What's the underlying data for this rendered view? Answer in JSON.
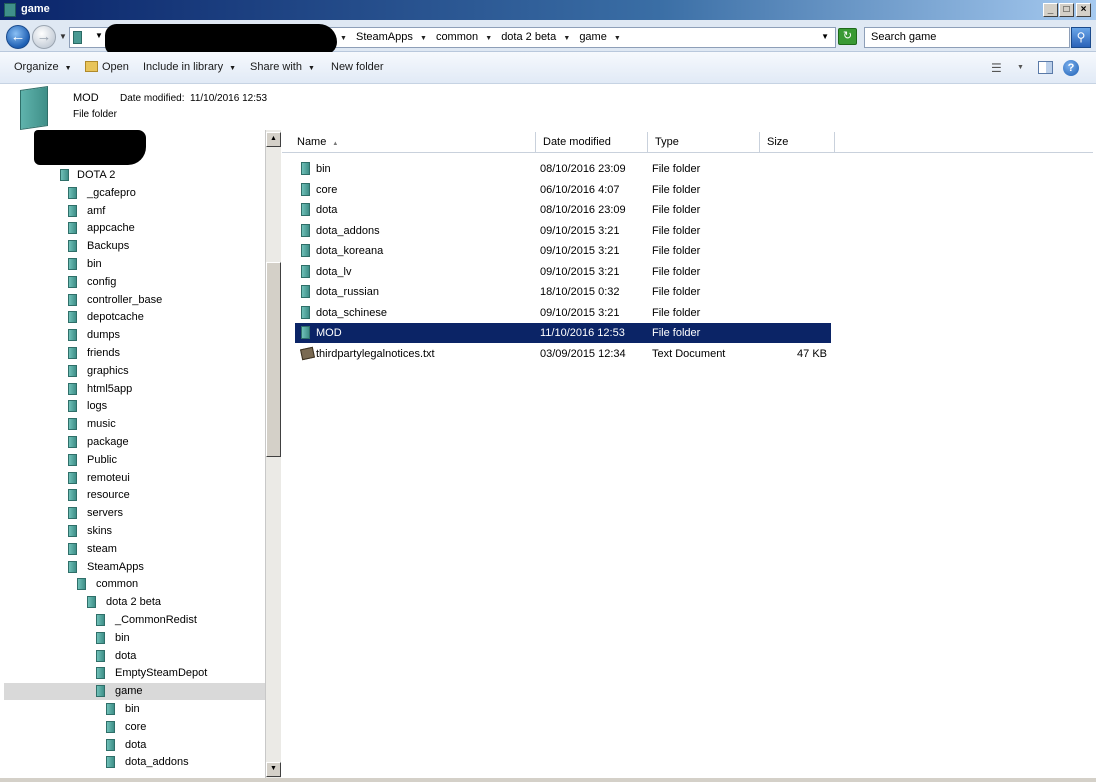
{
  "window": {
    "title": "game",
    "min_glyph": "_",
    "max_glyph": "□",
    "close_glyph": "×"
  },
  "address": {
    "crumbs": [
      "SteamApps",
      "common",
      "dota 2 beta",
      "game"
    ],
    "search_placeholder": "Search game"
  },
  "toolbar": {
    "organize": "Organize",
    "open": "Open",
    "include_in_library": "Include in library",
    "share_with": "Share with",
    "new_folder": "New folder"
  },
  "details": {
    "name": "MOD",
    "modified_label": "Date modified:",
    "modified_value": "11/10/2016 12:53",
    "type": "File folder"
  },
  "columns": {
    "name": "Name",
    "date": "Date modified",
    "type": "Type",
    "size": "Size"
  },
  "files": [
    {
      "name": "bin",
      "date": "08/10/2016 23:09",
      "type": "File folder",
      "size": "",
      "icon": "folder-icon"
    },
    {
      "name": "core",
      "date": "06/10/2016 4:07",
      "type": "File folder",
      "size": "",
      "icon": "folder-icon"
    },
    {
      "name": "dota",
      "date": "08/10/2016 23:09",
      "type": "File folder",
      "size": "",
      "icon": "folder-icon"
    },
    {
      "name": "dota_addons",
      "date": "09/10/2015 3:21",
      "type": "File folder",
      "size": "",
      "icon": "folder-icon"
    },
    {
      "name": "dota_koreana",
      "date": "09/10/2015 3:21",
      "type": "File folder",
      "size": "",
      "icon": "folder-icon"
    },
    {
      "name": "dota_lv",
      "date": "09/10/2015 3:21",
      "type": "File folder",
      "size": "",
      "icon": "folder-icon"
    },
    {
      "name": "dota_russian",
      "date": "18/10/2015 0:32",
      "type": "File folder",
      "size": "",
      "icon": "folder-icon"
    },
    {
      "name": "dota_schinese",
      "date": "09/10/2015 3:21",
      "type": "File folder",
      "size": "",
      "icon": "folder-icon"
    },
    {
      "name": "MOD",
      "date": "11/10/2016 12:53",
      "type": "File folder",
      "size": "",
      "icon": "folder-icon",
      "selected": true
    },
    {
      "name": "thirdpartylegalnotices.txt",
      "date": "03/09/2015 12:34",
      "type": "Text Document",
      "size": "47 KB",
      "icon": "text-document-icon"
    }
  ],
  "tree": [
    {
      "label": "DOTA 2",
      "level": 0
    },
    {
      "label": "_gcafepro",
      "level": 1
    },
    {
      "label": "amf",
      "level": 1
    },
    {
      "label": "appcache",
      "level": 1
    },
    {
      "label": "Backups",
      "level": 1
    },
    {
      "label": "bin",
      "level": 1
    },
    {
      "label": "config",
      "level": 1
    },
    {
      "label": "controller_base",
      "level": 1
    },
    {
      "label": "depotcache",
      "level": 1
    },
    {
      "label": "dumps",
      "level": 1
    },
    {
      "label": "friends",
      "level": 1
    },
    {
      "label": "graphics",
      "level": 1
    },
    {
      "label": "html5app",
      "level": 1
    },
    {
      "label": "logs",
      "level": 1
    },
    {
      "label": "music",
      "level": 1
    },
    {
      "label": "package",
      "level": 1
    },
    {
      "label": "Public",
      "level": 1
    },
    {
      "label": "remoteui",
      "level": 1
    },
    {
      "label": "resource",
      "level": 1
    },
    {
      "label": "servers",
      "level": 1
    },
    {
      "label": "skins",
      "level": 1
    },
    {
      "label": "steam",
      "level": 1
    },
    {
      "label": "SteamApps",
      "level": 1
    },
    {
      "label": "common",
      "level": 2
    },
    {
      "label": "dota 2 beta",
      "level": 3
    },
    {
      "label": "_CommonRedist",
      "level": 4
    },
    {
      "label": "bin",
      "level": 4
    },
    {
      "label": "dota",
      "level": 4
    },
    {
      "label": "EmptySteamDepot",
      "level": 4
    },
    {
      "label": "game",
      "level": 4,
      "selected": true
    },
    {
      "label": "bin",
      "level": 5
    },
    {
      "label": "core",
      "level": 5
    },
    {
      "label": "dota",
      "level": 5
    },
    {
      "label": "dota_addons",
      "level": 5
    }
  ]
}
